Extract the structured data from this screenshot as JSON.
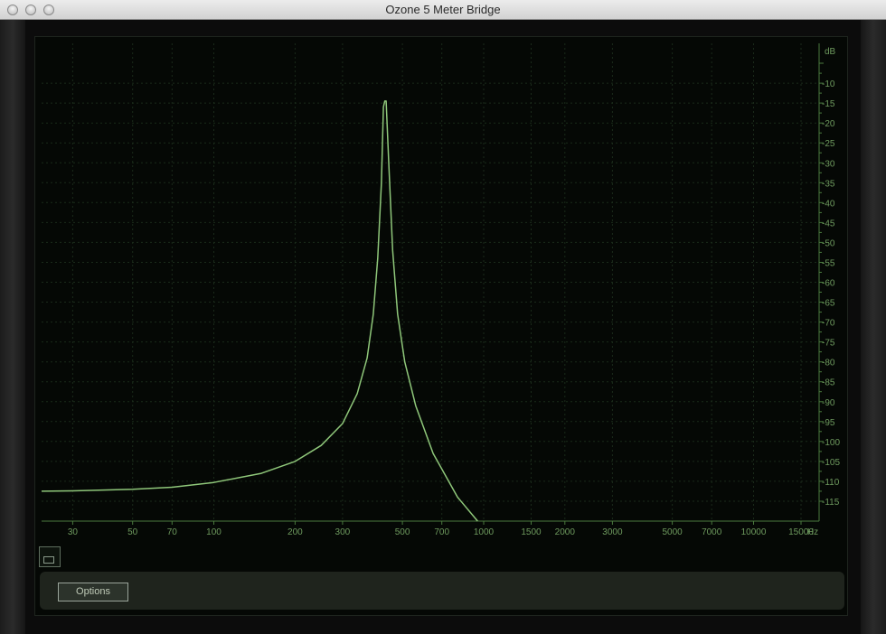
{
  "window": {
    "title": "Ozone 5 Meter Bridge"
  },
  "options": {
    "label": "Options"
  },
  "colors": {
    "curve": "#8fc77a",
    "axis": "#4a7a3e",
    "grid": "#1a2a1a",
    "tick_text": "#6e9a5e",
    "highlight_tick": "#d6e8b0"
  },
  "icons": [
    "close-button",
    "minimize-button",
    "zoom-button",
    "view-toggle-icon"
  ],
  "chart_data": {
    "type": "line",
    "title": "",
    "xlabel": "Hz",
    "ylabel": "dB",
    "x_scale": "log",
    "xlim": [
      23,
      17500
    ],
    "ylim": [
      -120,
      0
    ],
    "grid": true,
    "x_ticks": [
      {
        "v": 30,
        "l": "30"
      },
      {
        "v": 50,
        "l": "50"
      },
      {
        "v": 70,
        "l": "70"
      },
      {
        "v": 100,
        "l": "100"
      },
      {
        "v": 200,
        "l": "200"
      },
      {
        "v": 300,
        "l": "300"
      },
      {
        "v": 500,
        "l": "500"
      },
      {
        "v": 700,
        "l": "700"
      },
      {
        "v": 1000,
        "l": "1000"
      },
      {
        "v": 1500,
        "l": "1500"
      },
      {
        "v": 2000,
        "l": "2000"
      },
      {
        "v": 3000,
        "l": "3000"
      },
      {
        "v": 5000,
        "l": "5000"
      },
      {
        "v": 7000,
        "l": "7000"
      },
      {
        "v": 10000,
        "l": "10000"
      },
      {
        "v": 15000,
        "l": "15000"
      }
    ],
    "x_highlight": "300",
    "y_ticks": [
      -10,
      -15,
      -20,
      -25,
      -30,
      -35,
      -40,
      -45,
      -50,
      -55,
      -60,
      -65,
      -70,
      -75,
      -80,
      -85,
      -90,
      -95,
      -100,
      -105,
      -110,
      -115
    ],
    "y_tick_labels": [
      "-10",
      "-15",
      "-20",
      "-25",
      "-30",
      "-35",
      "-40",
      "-45",
      "-50",
      "-55",
      "-60",
      "-65",
      "-70",
      "-75",
      "-80",
      "-85",
      "-90",
      "-95",
      "-100",
      "-105",
      "-110",
      "-115"
    ],
    "series": [
      {
        "x": [
          23,
          30,
          50,
          70,
          100,
          150,
          200,
          250,
          300,
          340,
          370,
          390,
          405,
          418,
          425,
          430,
          435,
          445,
          460,
          480,
          510,
          560,
          650,
          800,
          950
        ],
        "y": [
          -112.5,
          -112.4,
          -112,
          -111.5,
          -110.3,
          -108,
          -105,
          -101,
          -95.5,
          -88,
          -79,
          -68,
          -54,
          -35,
          -16,
          -14.5,
          -14.5,
          -30,
          -52,
          -68,
          -80,
          -91,
          -103,
          -114,
          -121
        ]
      }
    ]
  }
}
